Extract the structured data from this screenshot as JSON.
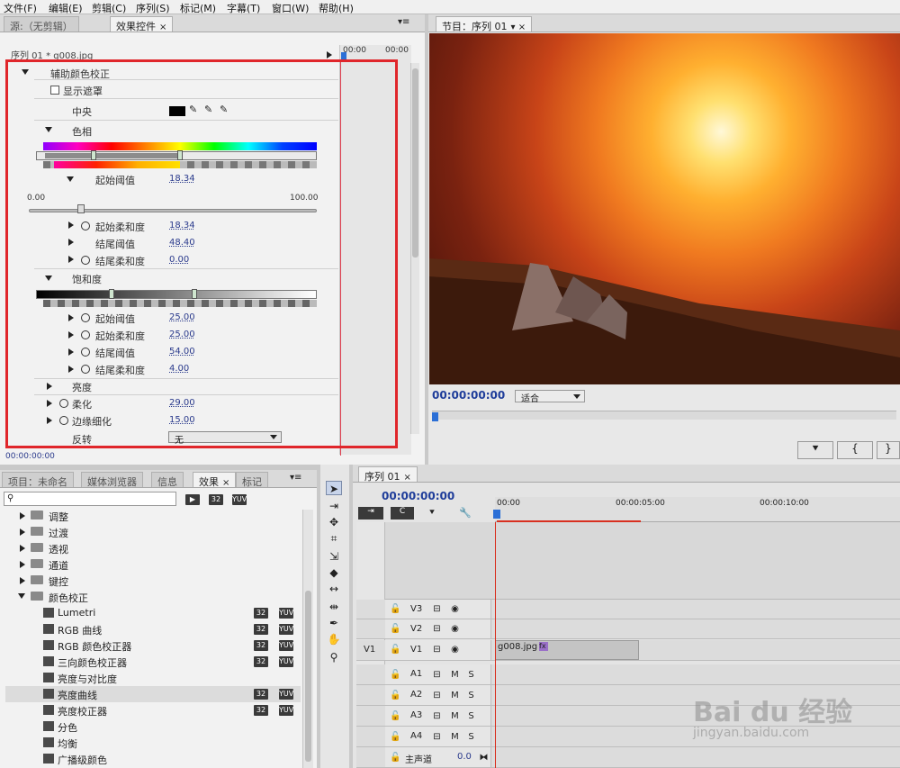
{
  "menu": [
    "文件(F)",
    "编辑(E)",
    "剪辑(C)",
    "序列(S)",
    "标记(M)",
    "字幕(T)",
    "窗口(W)",
    "帮助(H)"
  ],
  "source_panel": {
    "tab_source": "源:（无剪辑）",
    "tab_effect_controls": "效果控件",
    "close": "×",
    "menu": "▾≡"
  },
  "effect_controls": {
    "clip_label": "序列 01 * g008.jpg",
    "time_start": "00:00",
    "time_end": "00:00",
    "effect_name": "辅助颜色校正",
    "show_mask": "显示遮罩",
    "center": "中央",
    "hue": "色相",
    "start_threshold": "起始阈值",
    "start_threshold_val": "18.34",
    "range_min": "0.00",
    "range_max": "100.00",
    "hue_start_softness": "起始柔和度",
    "hue_start_softness_val": "18.34",
    "hue_end_threshold": "结尾阈值",
    "hue_end_threshold_val": "48.40",
    "hue_end_softness": "结尾柔和度",
    "hue_end_softness_val": "0.00",
    "saturation": "饱和度",
    "sat_start_threshold": "起始阈值",
    "sat_start_threshold_val": "25.00",
    "sat_start_softness": "起始柔和度",
    "sat_start_softness_val": "25.00",
    "sat_end_threshold": "结尾阈值",
    "sat_end_threshold_val": "54.00",
    "sat_end_softness": "结尾柔和度",
    "sat_end_softness_val": "4.00",
    "brightness": "亮度",
    "soften": "柔化",
    "soften_val": "29.00",
    "edge_thin": "边缘细化",
    "edge_thin_val": "15.00",
    "invert": "反转",
    "invert_val": "无",
    "timecode": "00:00:00:00"
  },
  "program": {
    "tab": "节目：序列 01",
    "timecode": "00:00:00:00",
    "fit": "适合"
  },
  "project_panel": {
    "tabs": [
      "项目：未命名",
      "媒体浏览器",
      "信息",
      "效果",
      "标记"
    ],
    "search_placeholder": "",
    "folders": [
      "调整",
      "过渡",
      "透视",
      "通道",
      "键控",
      "颜色校正"
    ],
    "items": [
      {
        "name": "Lumetri",
        "b32": "32",
        "yuv": "YUV"
      },
      {
        "name": "RGB 曲线",
        "b32": "32",
        "yuv": "YUV"
      },
      {
        "name": "RGB 颜色校正器",
        "b32": "32",
        "yuv": "YUV"
      },
      {
        "name": "三向颜色校正器",
        "b32": "32",
        "yuv": "YUV"
      },
      {
        "name": "亮度与对比度",
        "b32": "",
        "yuv": ""
      },
      {
        "name": "亮度曲线",
        "b32": "32",
        "yuv": "YUV"
      },
      {
        "name": "亮度校正器",
        "b32": "32",
        "yuv": "YUV"
      },
      {
        "name": "分色",
        "b32": "",
        "yuv": ""
      },
      {
        "name": "均衡",
        "b32": "",
        "yuv": ""
      },
      {
        "name": "广播级颜色",
        "b32": "",
        "yuv": ""
      }
    ]
  },
  "timeline": {
    "tab": "序列 01",
    "timecode": "00:00:00:00",
    "ruler": [
      "00:00",
      "00:00:05:00",
      "00:00:10:00"
    ],
    "video_tracks": [
      "V3",
      "V2",
      "V1"
    ],
    "source_patch": "V1",
    "clip": "g008.jpg",
    "audio_tracks": [
      "A1",
      "A2",
      "A3",
      "A4"
    ],
    "master": "主声道",
    "master_val": "0.0",
    "m": "M",
    "s": "S"
  },
  "watermark": {
    "brand": "Bai du 经验",
    "url": "jingyan.baidu.com"
  },
  "colors": {
    "highlight": "#e0262b",
    "playhead": "#2b6fd6"
  }
}
